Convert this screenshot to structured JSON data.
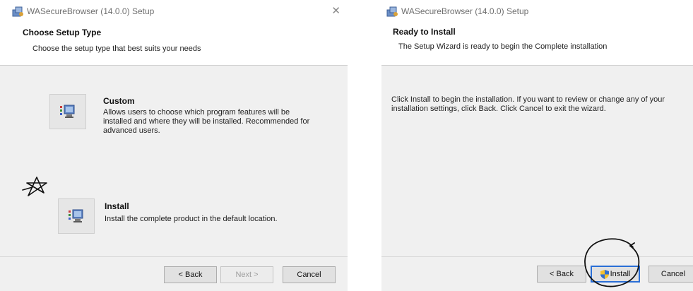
{
  "left_window": {
    "title": "WASecureBrowser (14.0.0) Setup",
    "close_glyph": "✕",
    "header_title": "Choose Setup Type",
    "header_subtitle": "Choose the setup type that best suits your needs",
    "options": [
      {
        "title": "Custom",
        "description": "Allows users to choose which program features will be installed and where they will be installed. Recommended for advanced users.",
        "icon": "setup-type-icon"
      },
      {
        "title": "Install",
        "description": "Install the complete product in the default location.",
        "icon": "setup-type-icon"
      }
    ],
    "buttons": {
      "back": "< Back",
      "next": "Next >",
      "cancel": "Cancel"
    }
  },
  "right_window": {
    "title": "WASecureBrowser (14.0.0) Setup",
    "header_title": "Ready to Install",
    "header_subtitle": "The Setup Wizard is ready to begin the Complete installation",
    "body_text": "Click Install to begin the installation.  If you want to review or change any of your installation settings, click Back.  Click Cancel to exit the wizard.",
    "buttons": {
      "back": "< Back",
      "install": "Install",
      "cancel": "Cancel"
    },
    "install_icon": "uac-shield-icon"
  },
  "annotations": {
    "left_mark": "hand-drawn-star-arrow",
    "right_mark": "hand-drawn-circle-around-install"
  },
  "colors": {
    "window_bg": "#f0f0f0",
    "header_bg": "#ffffff",
    "button_bg": "#e1e1e1",
    "default_button_border": "#2a6fd6",
    "ink": "#111111"
  }
}
